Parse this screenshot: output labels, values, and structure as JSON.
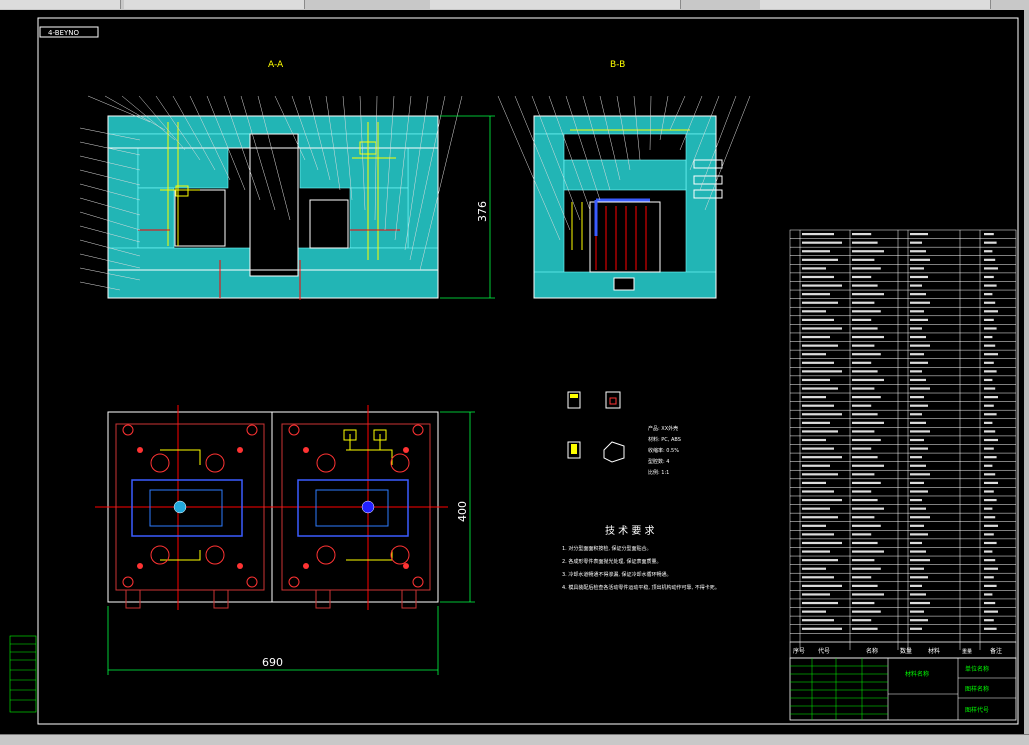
{
  "drawing": {
    "corner_label": "4-BEYNO",
    "section_aa_label": "A-A",
    "section_bb_label": "B-B",
    "dim_height": "376",
    "dim_plan_height": "400",
    "dim_plan_width": "690",
    "product_info": [
      "产品: XX外壳",
      "材料: PC, ABS",
      "收缩率: 0.5%",
      "型腔数: 4",
      "比例: 1:1"
    ],
    "tech_req_title": "技 术 要 求",
    "tech_req_items": [
      "1. 对分型面面积按检, 保证分型面贴合。",
      "2. 各成形零件表面抛光处理, 保证表面质量。",
      "3. 冷却水道畅通不得渗漏, 保证冷却水循环畅通。",
      "4. 模具装配后检查各活动零件运动平稳, 顶出机构动作可靠, 不得卡死。"
    ]
  },
  "title_block": {
    "header_seq": "序号",
    "header_code": "代号",
    "header_name": "名称",
    "header_qty": "数量",
    "header_material": "材料",
    "header_weight": "重量",
    "header_note": "备注",
    "field_material_name": "材料名称",
    "field_unit_name": "单位名称",
    "field_drawing_name": "图样名称",
    "field_drawing_no": "图样代号"
  },
  "colors": {
    "background": "#000000",
    "outline": "#ffffff",
    "mold_plate": "#22b5b5",
    "ejector_highlight": "#ffff00",
    "cooling_center_lines": "#ff0000",
    "insert_blue": "#3a5cff",
    "dimension_green": "#00ff40",
    "title_text": "#00ff00"
  }
}
